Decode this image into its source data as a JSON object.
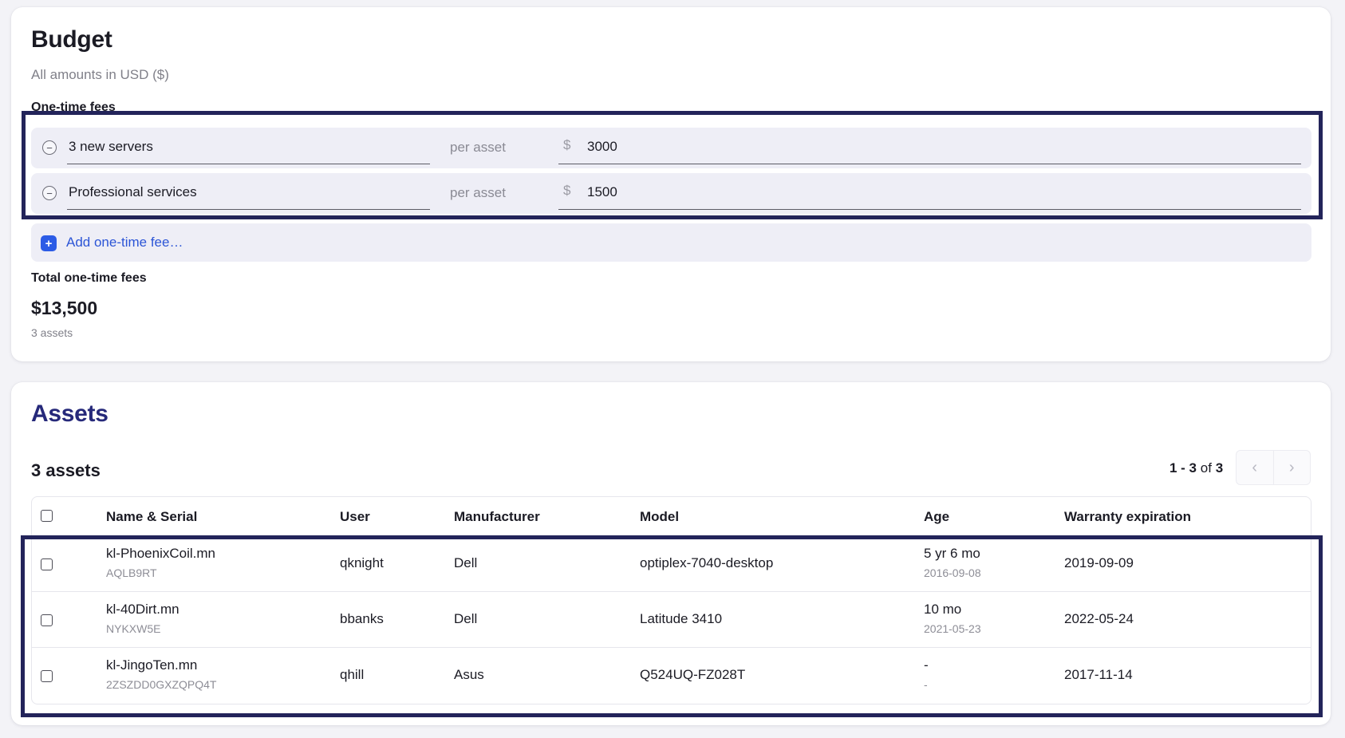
{
  "budget": {
    "title": "Budget",
    "subtitle": "All amounts in USD ($)",
    "one_time_label": "One-time fees",
    "fees": [
      {
        "name": "3 new servers",
        "unit": "per asset",
        "currency": "$",
        "amount": "3000"
      },
      {
        "name": "Professional services",
        "unit": "per asset",
        "currency": "$",
        "amount": "1500"
      }
    ],
    "add_fee_label": "Add one-time fee…",
    "total_label": "Total one-time fees",
    "total_value": "$13,500",
    "total_assets": "3 assets"
  },
  "assets": {
    "title": "Assets",
    "count_label": "3 assets",
    "pagination": {
      "range": "1 - 3",
      "of": "of",
      "total": "3"
    },
    "columns": [
      "Name & Serial",
      "User",
      "Manufacturer",
      "Model",
      "Age",
      "Warranty expiration"
    ],
    "rows": [
      {
        "name": "kl-PhoenixCoil.mn",
        "serial": "AQLB9RT",
        "user": "qknight",
        "manufacturer": "Dell",
        "model": "optiplex-7040-desktop",
        "age": "5 yr 6 mo",
        "age_date": "2016-09-08",
        "warranty": "2019-09-09"
      },
      {
        "name": "kl-40Dirt.mn",
        "serial": "NYKXW5E",
        "user": "bbanks",
        "manufacturer": "Dell",
        "model": "Latitude 3410",
        "age": "10 mo",
        "age_date": "2021-05-23",
        "warranty": "2022-05-24"
      },
      {
        "name": "kl-JingoTen.mn",
        "serial": "2ZSZDD0GXZQPQ4T",
        "user": "qhill",
        "manufacturer": "Asus",
        "model": "Q524UQ-FZ028T",
        "age": "-",
        "age_date": "-",
        "warranty": "2017-11-14"
      }
    ]
  },
  "colors": {
    "accent": "#2c5ce6",
    "assets_title": "#26297a",
    "highlight_border": "#23245a",
    "row_bg": "#eeeef6"
  },
  "icons": {
    "remove": "minus-circle-icon",
    "add": "plus-square-icon",
    "prev": "chevron-left-icon",
    "next": "chevron-right-icon"
  }
}
